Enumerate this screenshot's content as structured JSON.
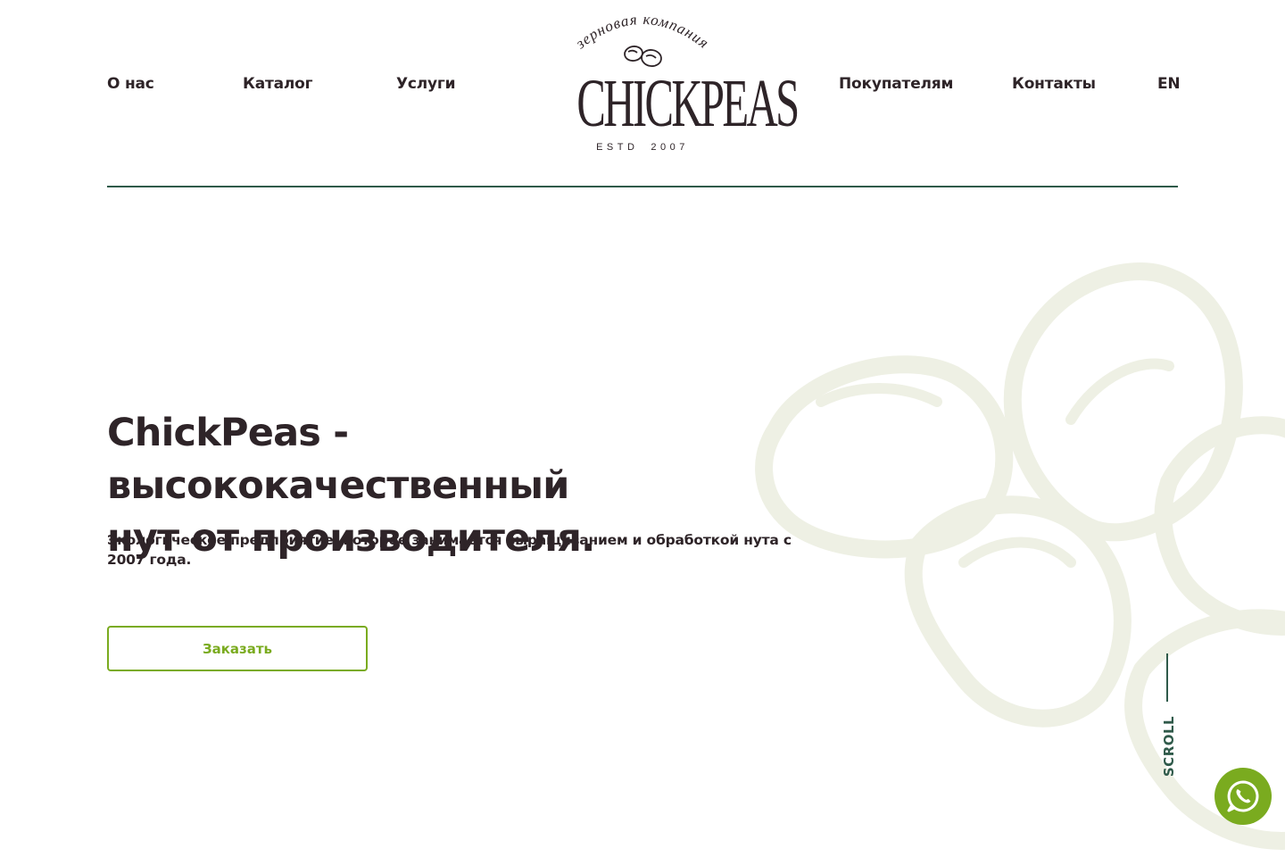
{
  "nav": {
    "about": "О нас",
    "catalog": "Каталог",
    "services": "Услуги",
    "buyers": "Покупателям",
    "contacts": "Контакты",
    "language": "EN"
  },
  "logo": {
    "tagline": "зерновая компания",
    "brand": "CHICKPEAS",
    "estd_label": "ESTD",
    "estd_year": "2007"
  },
  "hero": {
    "title_line1": "ChickPeas - высококачественный",
    "title_line2": "нут от производителя.",
    "subtitle": "Экологическое предприятие, которое занимается выращиванием и обработкой нута с 2007 года.",
    "order_button": "Заказать"
  },
  "scroll_label": "SCROLL",
  "icons": {
    "chickpea_logo": "chickpea-icon",
    "whatsapp": "whatsapp-icon"
  },
  "colors": {
    "text": "#2e2428",
    "accent_green": "#7aab1f",
    "divider_green": "#2f5a4a",
    "decor": "#eef0e4"
  }
}
